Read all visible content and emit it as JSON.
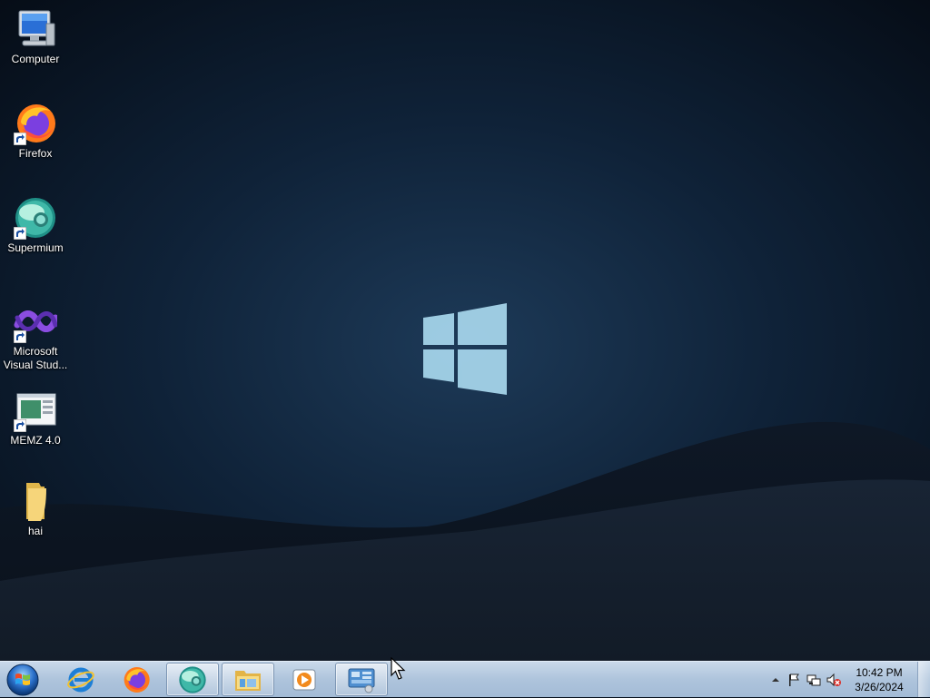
{
  "desktop": {
    "icons": [
      {
        "label": "Computer",
        "icon": "computer-icon",
        "shortcut": false
      },
      {
        "label": "Firefox",
        "icon": "firefox-icon",
        "shortcut": true
      },
      {
        "label": "Supermium",
        "icon": "supermium-icon",
        "shortcut": true
      },
      {
        "label": "Microsoft Visual Stud...",
        "icon": "visual-studio-icon",
        "shortcut": true
      },
      {
        "label": "MEMZ 4.0",
        "icon": "memz-icon",
        "shortcut": true
      },
      {
        "label": "hai",
        "icon": "folder-icon",
        "shortcut": false
      }
    ]
  },
  "taskbar": {
    "start": "windows-start-orb",
    "pinned": [
      {
        "name": "internet-explorer",
        "icon": "internet-explorer-icon",
        "open": false
      },
      {
        "name": "firefox",
        "icon": "firefox-icon",
        "open": false
      },
      {
        "name": "supermium",
        "icon": "supermium-icon",
        "open": true
      },
      {
        "name": "windows-explorer",
        "icon": "folder-explorer-icon",
        "open": true
      },
      {
        "name": "media-player",
        "icon": "media-player-icon",
        "open": false
      },
      {
        "name": "control-panel",
        "icon": "control-panel-icon",
        "open": true
      }
    ],
    "tray": {
      "icons": [
        "show-hidden-arrow-icon",
        "action-center-flag-icon",
        "network-icon",
        "volume-muted-icon"
      ],
      "time": "10:42 PM",
      "date": "3/26/2024"
    }
  },
  "colors": {
    "accent": "#a8d8ee",
    "taskbar": "#aec4dc"
  }
}
